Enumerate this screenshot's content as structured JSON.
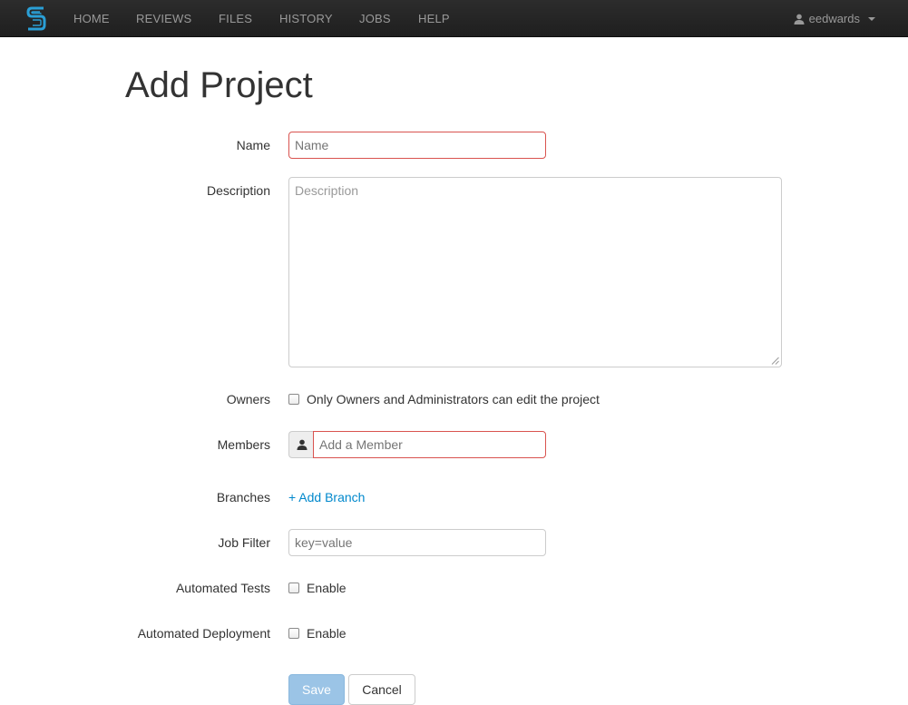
{
  "nav": {
    "items": [
      {
        "label": "HOME"
      },
      {
        "label": "REVIEWS"
      },
      {
        "label": "FILES"
      },
      {
        "label": "HISTORY"
      },
      {
        "label": "JOBS"
      },
      {
        "label": "HELP"
      }
    ],
    "user": "eedwards"
  },
  "page": {
    "title": "Add Project"
  },
  "form": {
    "name": {
      "label": "Name",
      "placeholder": "Name",
      "value": ""
    },
    "description": {
      "label": "Description",
      "placeholder": "Description",
      "value": ""
    },
    "owners": {
      "label": "Owners",
      "checkbox_text": "Only Owners and Administrators can edit the project",
      "checked": false
    },
    "members": {
      "label": "Members",
      "placeholder": "Add a Member",
      "value": ""
    },
    "branches": {
      "label": "Branches",
      "link": "+ Add Branch"
    },
    "job_filter": {
      "label": "Job Filter",
      "placeholder": "key=value",
      "value": ""
    },
    "automated_tests": {
      "label": "Automated Tests",
      "checkbox_text": "Enable",
      "checked": false
    },
    "automated_deployment": {
      "label": "Automated Deployment",
      "checkbox_text": "Enable",
      "checked": false
    },
    "save_label": "Save",
    "cancel_label": "Cancel"
  },
  "colors": {
    "navbar": "#222222",
    "brand": "#2a9fd6",
    "link": "#0088cc",
    "error_border": "#d9534f",
    "save_button": "#9bc4e6"
  }
}
